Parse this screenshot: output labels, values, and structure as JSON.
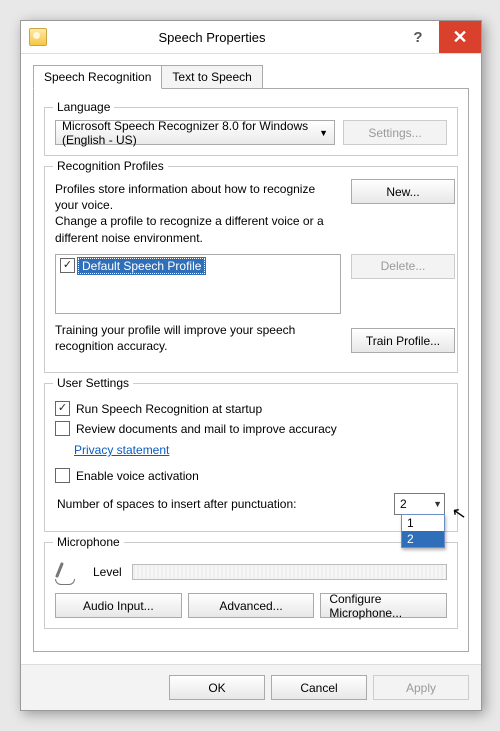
{
  "titlebar": {
    "title": "Speech Properties"
  },
  "tabs": {
    "recognition": "Speech Recognition",
    "tts": "Text to Speech"
  },
  "language": {
    "group_label": "Language",
    "engine": "Microsoft Speech Recognizer 8.0 for Windows (English - US)",
    "settings_btn": "Settings..."
  },
  "profiles": {
    "group_label": "Recognition Profiles",
    "desc1": "Profiles store information about how to recognize your voice.",
    "desc2": "Change a profile to recognize a different voice or a different noise environment.",
    "default_profile": "Default Speech Profile",
    "new_btn": "New...",
    "delete_btn": "Delete...",
    "train_desc": "Training your profile will improve your speech recognition accuracy.",
    "train_btn": "Train Profile..."
  },
  "user_settings": {
    "group_label": "User Settings",
    "run_startup": "Run Speech Recognition at startup",
    "review_docs": "Review documents and mail to improve accuracy",
    "privacy": "Privacy statement",
    "enable_voice": "Enable voice activation",
    "spaces_label": "Number of spaces to insert after punctuation:",
    "spaces_value": "2",
    "spaces_options": [
      "1",
      "2"
    ]
  },
  "microphone": {
    "group_label": "Microphone",
    "level_label": "Level",
    "audio_input_btn": "Audio Input...",
    "advanced_btn": "Advanced...",
    "configure_btn": "Configure Microphone..."
  },
  "footer": {
    "ok": "OK",
    "cancel": "Cancel",
    "apply": "Apply"
  }
}
